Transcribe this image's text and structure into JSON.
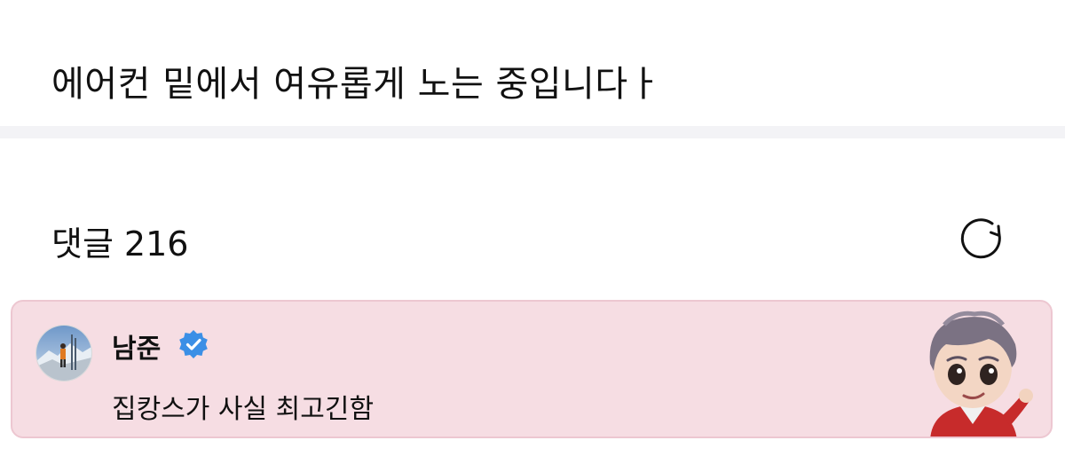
{
  "post": {
    "text": "에어컨 밑에서 여유롭게 노는 중입니다ㅏ"
  },
  "comments": {
    "label": "댓글",
    "count": "216",
    "refresh_icon": "refresh-icon"
  },
  "comment": {
    "author": "남준",
    "verified_icon": "verified-badge-icon",
    "body": "집캉스가 사실 최고긴함",
    "highlight_color": "#f6dde3",
    "verified_color": "#3b8fe6"
  }
}
